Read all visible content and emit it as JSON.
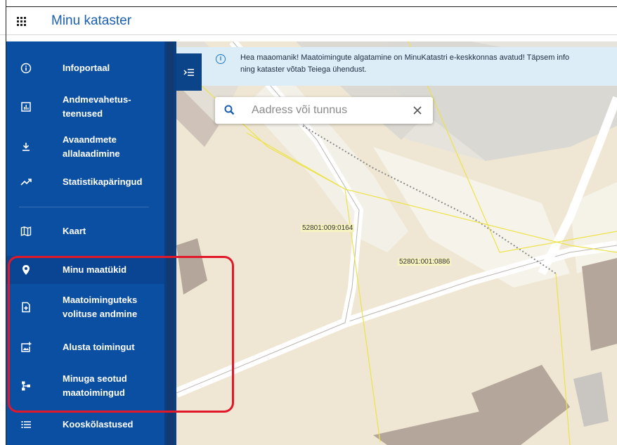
{
  "app": {
    "title": "Minu kataster"
  },
  "sidebar": {
    "items": [
      {
        "label": "Infoportaal",
        "icon": "info-icon"
      },
      {
        "label": "Andmevahetus-\nteenused",
        "icon": "chart-icon"
      },
      {
        "label": "Avaandmete\nallalaadimine",
        "icon": "download-icon"
      },
      {
        "label": "Statistikapäringud",
        "icon": "trending-icon"
      },
      {
        "label": "Kaart",
        "icon": "map-icon"
      },
      {
        "label": "Minu maatükid",
        "icon": "location-pin-icon"
      },
      {
        "label": "Maatoiminguteks\nvolituse andmine",
        "icon": "document-add-icon"
      },
      {
        "label": "Alusta toimingut",
        "icon": "add-image-icon"
      },
      {
        "label": "Minuga seotud\nmaatoimingud",
        "icon": "tree-icon"
      },
      {
        "label": "Kooskõlastused",
        "icon": "list-icon"
      }
    ]
  },
  "banner": {
    "line1": "Hea maaomanik! Maatoimingute algatamine on MinuKatastri e-keskkonnas avatud! Täpsem info",
    "line2": "ning kataster võtab Teiega ühendust."
  },
  "search": {
    "placeholder": "Aadress või tunnus",
    "value": ""
  },
  "map": {
    "parcels": [
      "52801:009:0164",
      "52801:001:0886"
    ]
  },
  "colors": {
    "sidebar": "#0b4fa3",
    "accent": "#1b5fb0",
    "highlight": "#e0182a",
    "banner": "#dcedf8"
  }
}
